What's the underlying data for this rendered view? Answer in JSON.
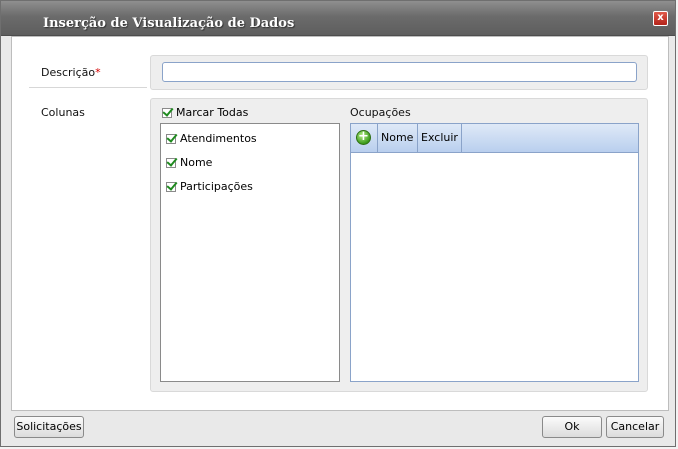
{
  "window": {
    "title": "Inserção de Visualização de Dados",
    "close_label": "x"
  },
  "form": {
    "descricao_label": "Descrição",
    "required_marker": "*",
    "descricao_value": "",
    "colunas_label": "Colunas",
    "marcar_todas_label": "Marcar Todas",
    "columns": [
      "Atendimentos",
      "Nome",
      "Participações"
    ],
    "ocupacoes_label": "Ocupações",
    "grid_headers": {
      "nome": "Nome",
      "excluir": "Excluir"
    }
  },
  "footer": {
    "solicitacoes": "Solicitações",
    "ok": "Ok",
    "cancelar": "Cancelar"
  }
}
